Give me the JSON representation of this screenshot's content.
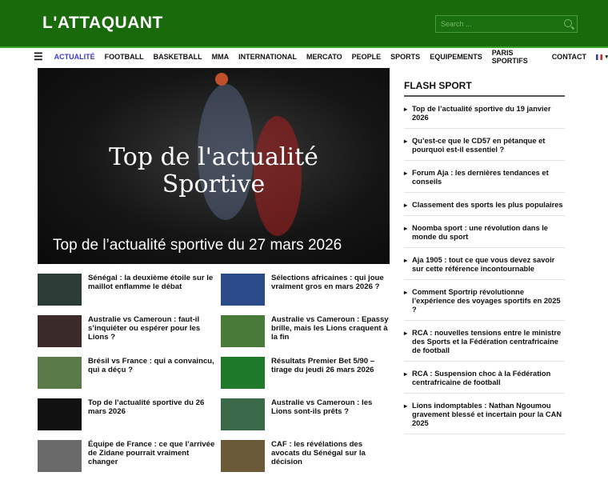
{
  "header": {
    "logo": "L'ATTAQUANT",
    "search_placeholder": "Search ..."
  },
  "nav": {
    "items": [
      "ACTUALITÉ",
      "FOOTBALL",
      "BASKETBALL",
      "MMA",
      "INTERNATIONAL",
      "MERCATO",
      "PEOPLE",
      "SPORTS",
      "EQUIPEMENTS",
      "PARIS SPORTIFS",
      "CONTACT"
    ],
    "lang": "▾"
  },
  "hero": {
    "image_text_1": "Top de l'actualité",
    "image_text_2": "Sportive",
    "caption": "Top de l’actualité sportive du 27 mars 2026"
  },
  "articles": [
    {
      "title": "Sénégal : la deuxième étoile sur le maillot enflamme le débat",
      "color": "#2b3b35"
    },
    {
      "title": "Sélections africaines : qui joue vraiment gros en mars 2026 ?",
      "color": "#2a4a8a"
    },
    {
      "title": "Australie vs Cameroun : faut-il s’inquiéter ou espérer pour les Lions ?",
      "color": "#3a2a2a"
    },
    {
      "title": "Australie vs Cameroun : Epassy brille, mais les Lions craquent à la fin",
      "color": "#4a7a3a"
    },
    {
      "title": "Brésil vs France : qui a convaincu, qui a déçu ?",
      "color": "#5a7a4a"
    },
    {
      "title": "Résultats Premier Bet 5/90 – tirage du jeudi 26 mars 2026",
      "color": "#1e7a2a"
    },
    {
      "title": "Top de l’actualité sportive du 26 mars 2026",
      "color": "#111111"
    },
    {
      "title": "Australie vs Cameroun : les Lions sont-ils prêts ?",
      "color": "#3a6a4a"
    },
    {
      "title": "Équipe de France : ce que l’arrivée de Zidane pourrait vraiment changer",
      "color": "#6a6a6a"
    },
    {
      "title": "CAF : les révélations des avocats du Sénégal sur la décision",
      "color": "#6a5a3a"
    }
  ],
  "sidebar": {
    "title": "FLASH SPORT",
    "items": [
      "Top de l’actualité sportive du 19 janvier 2026",
      "Qu’est-ce que le CD57 en pétanque et pourquoi est-il essentiel ?",
      "Forum Aja : les dernières tendances et conseils",
      "Classement des sports les plus populaires",
      "Noomba sport : une révolution dans le monde du sport",
      "Aja 1905 : tout ce que vous devez savoir sur cette référence incontournable",
      "Comment Sportrip révolutionne l’expérience des voyages sportifs en 2025 ?",
      "RCA : nouvelles tensions entre le ministre des Sports et la Fédération centrafricaine de football",
      "RCA : Suspension choc à la Fédération centrafricaine de football",
      "Lions indomptables : Nathan Ngoumou gravement blessé et incertain pour la CAN 2025"
    ]
  }
}
